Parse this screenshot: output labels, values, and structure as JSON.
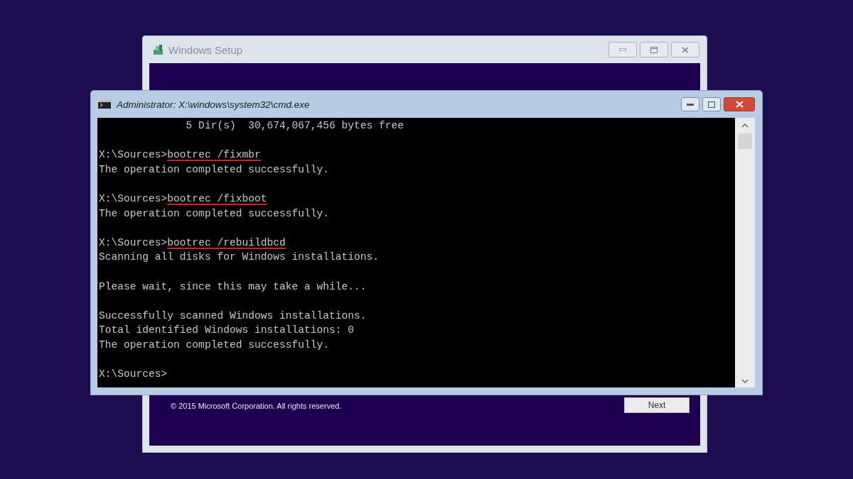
{
  "setup_window": {
    "title": "Windows Setup",
    "copyright": "© 2015 Microsoft Corporation. All rights reserved.",
    "next_button": "Next"
  },
  "cmd_window": {
    "title": "Administrator: X:\\windows\\system32\\cmd.exe"
  },
  "console": {
    "blocks": [
      {
        "lines": [
          {
            "text": "              5 Dir(s)  30,674,067,456 bytes free"
          }
        ]
      },
      {
        "lines": [
          {
            "prompt": "X:\\Sources>",
            "command": "bootrec /fixmbr",
            "underlined": true
          },
          {
            "text": "The operation completed successfully."
          }
        ]
      },
      {
        "lines": [
          {
            "prompt": "X:\\Sources>",
            "command": "bootrec /fixboot",
            "underlined": true
          },
          {
            "text": "The operation completed successfully."
          }
        ]
      },
      {
        "lines": [
          {
            "prompt": "X:\\Sources>",
            "command": "bootrec /rebuildbcd",
            "underlined": true
          },
          {
            "text": "Scanning all disks for Windows installations."
          }
        ]
      },
      {
        "lines": [
          {
            "text": "Please wait, since this may take a while..."
          }
        ]
      },
      {
        "lines": [
          {
            "text": "Successfully scanned Windows installations."
          },
          {
            "text": "Total identified Windows installations: 0"
          },
          {
            "text": "The operation completed successfully."
          }
        ]
      },
      {
        "lines": [
          {
            "prompt": "X:\\Sources>"
          }
        ]
      }
    ]
  }
}
